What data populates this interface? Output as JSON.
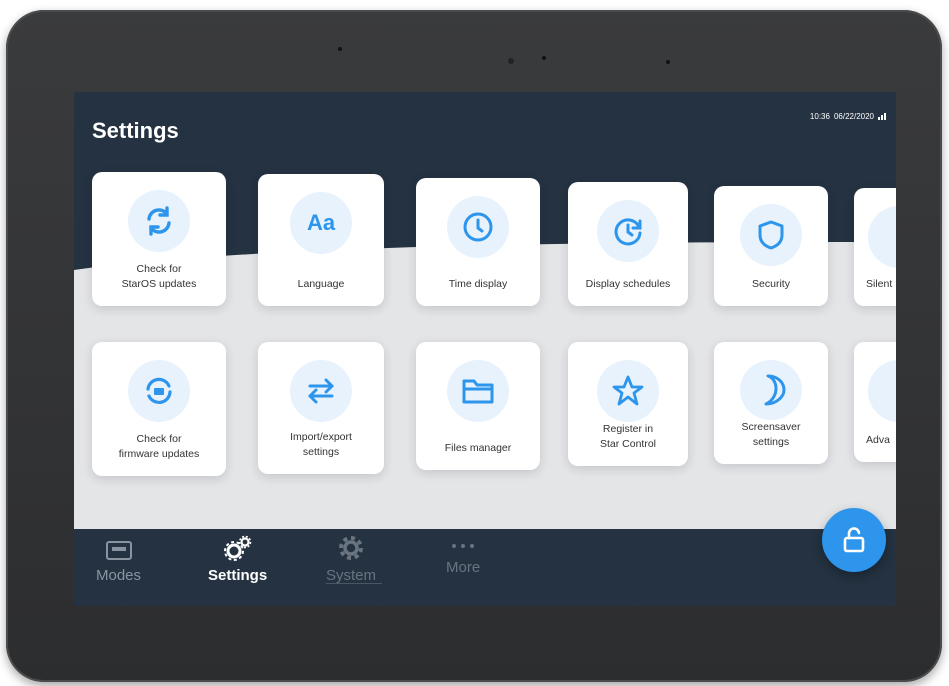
{
  "header": {
    "title": "Settings",
    "time": "10:36",
    "date": "06/22/2020",
    "signal_icon": "signal-icon"
  },
  "tiles_row1": [
    {
      "label": "Check for\nStarOS updates",
      "icon": "refresh-icon"
    },
    {
      "label": "Language",
      "icon": "language-icon"
    },
    {
      "label": "Time display",
      "icon": "clock-icon"
    },
    {
      "label": "Display schedules",
      "icon": "schedule-clock-icon"
    },
    {
      "label": "Security",
      "icon": "shield-icon"
    },
    {
      "label": "Silent",
      "icon": "bell-icon"
    }
  ],
  "tiles_row2": [
    {
      "label": "Check for\nfirmware updates",
      "icon": "firmware-update-icon"
    },
    {
      "label": "Import/export\nsettings",
      "icon": "import-export-icon"
    },
    {
      "label": "Files manager",
      "icon": "folder-icon"
    },
    {
      "label": "Register in\nStar Control",
      "icon": "star-icon"
    },
    {
      "label": "Screensaver\nsettings",
      "icon": "moon-icon"
    },
    {
      "label": "Adva",
      "icon": "advanced-icon"
    }
  ],
  "nav": {
    "modes": "Modes",
    "settings": "Settings",
    "system": "System",
    "more": "More"
  },
  "colors": {
    "header_bg": "#243241",
    "accent": "#2d95ec",
    "icon_bg": "#e7f2fd"
  },
  "lock_icon": "unlock-icon"
}
